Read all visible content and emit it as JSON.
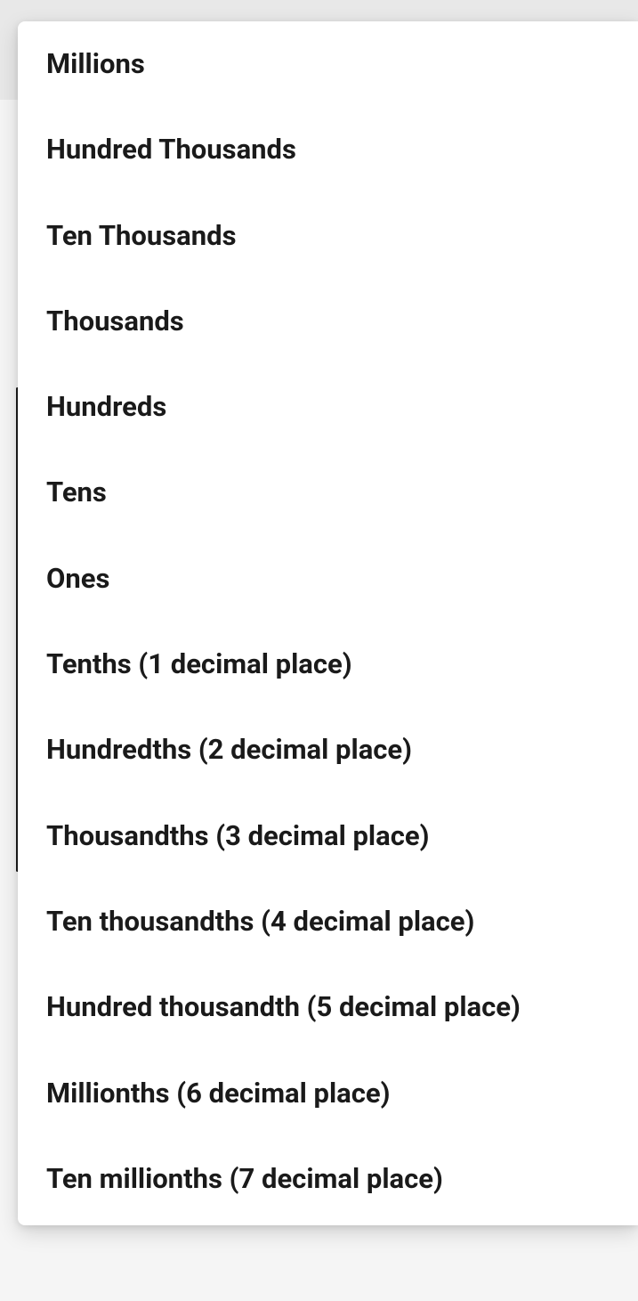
{
  "dropdown": {
    "options": [
      {
        "label": "Millions"
      },
      {
        "label": "Hundred Thousands"
      },
      {
        "label": "Ten Thousands"
      },
      {
        "label": "Thousands"
      },
      {
        "label": "Hundreds"
      },
      {
        "label": "Tens"
      },
      {
        "label": "Ones"
      },
      {
        "label": "Tenths (1 decimal place)"
      },
      {
        "label": "Hundredths (2 decimal place)"
      },
      {
        "label": "Thousandths (3 decimal place)"
      },
      {
        "label": "Ten thousandths (4 decimal place)"
      },
      {
        "label": "Hundred thousandth (5 decimal place)"
      },
      {
        "label": "Millionths (6 decimal place)"
      },
      {
        "label": "Ten millionths (7 decimal place)"
      }
    ]
  }
}
